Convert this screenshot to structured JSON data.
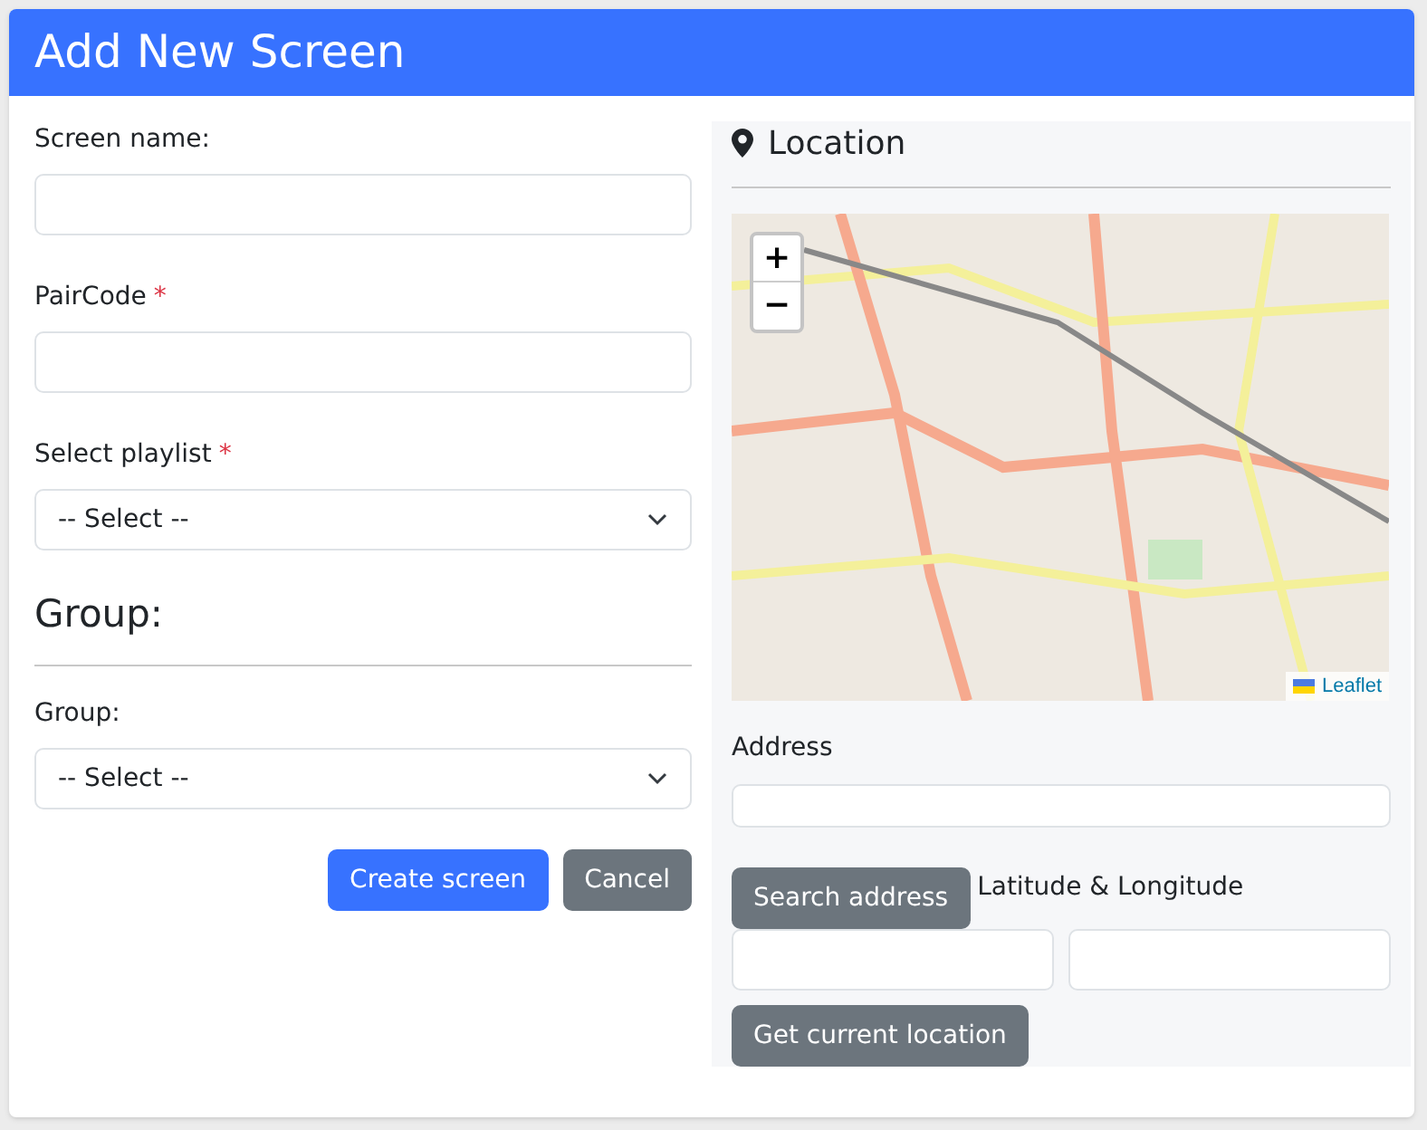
{
  "dialog": {
    "title": "Add New Screen"
  },
  "form": {
    "fields": [
      {
        "kind": "text",
        "label": "Screen name:"
      },
      {
        "kind": "text",
        "label": "PairCode",
        "required_mark": "*"
      },
      {
        "kind": "select",
        "label": "Select playlist",
        "required_mark": "*",
        "value": "-- Select --"
      }
    ],
    "group_section": {
      "heading": "Group:",
      "fields": [
        {
          "kind": "select",
          "label": "Group:",
          "value": "-- Select --"
        }
      ]
    },
    "buttons": [
      {
        "label": "Create screen",
        "kind": "primary"
      },
      {
        "label": "Cancel",
        "kind": "secondary"
      }
    ]
  },
  "location": {
    "heading": "Location",
    "map": {
      "zoom_in": "+",
      "zoom_out": "−",
      "attribution": "Leaflet"
    },
    "address_label": "Address",
    "search_button": "Search address",
    "coords_label": "Latitude & Longitude",
    "locate_button": "Get current location"
  }
}
